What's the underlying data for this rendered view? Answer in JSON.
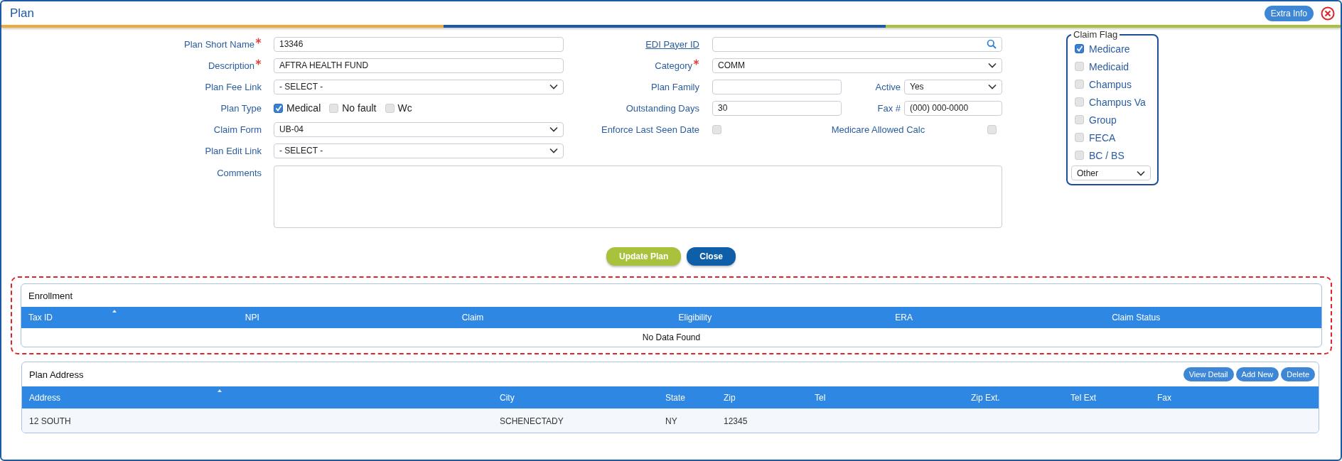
{
  "window": {
    "title": "Plan"
  },
  "extra_info_button": "Extra Info",
  "left_fields": [
    {
      "label": "Plan Short Name",
      "kind": "text",
      "value": "13346",
      "required": true
    },
    {
      "label": "Description",
      "kind": "text",
      "value": "AFTRA HEALTH FUND",
      "required": true
    },
    {
      "label": "Plan Fee Link",
      "kind": "select",
      "value": "- SELECT -",
      "required": false
    },
    {
      "label": "Plan Type",
      "kind": "checks",
      "required": false,
      "options": [
        {
          "label": "Medical",
          "checked": true
        },
        {
          "label": "No fault",
          "checked": false
        },
        {
          "label": "Wc",
          "checked": false
        }
      ]
    },
    {
      "label": "Claim Form",
      "kind": "select",
      "value": "UB-04",
      "required": false
    },
    {
      "label": "Plan Edit Link",
      "kind": "select",
      "value": "- SELECT -",
      "required": false
    },
    {
      "label": "Comments",
      "kind": "textarea",
      "required": false
    }
  ],
  "mid_rows": [
    {
      "fields": [
        {
          "label": "EDI Payer ID",
          "kind": "search",
          "link": true,
          "required": false
        }
      ]
    },
    {
      "fields": [
        {
          "label": "Category",
          "kind": "select",
          "value": "COMM",
          "link": false,
          "required": true
        }
      ]
    },
    {
      "fields": [
        {
          "label": "Plan Family",
          "kind": "text",
          "link": false,
          "required": false
        },
        {
          "label": "Active",
          "kind": "select",
          "value": "Yes",
          "link": false,
          "required": false
        }
      ]
    },
    {
      "fields": [
        {
          "label": "Outstanding Days",
          "kind": "text",
          "value": "30",
          "link": false,
          "required": false
        },
        {
          "label": "Fax #",
          "kind": "text",
          "value": "(000) 000-0000",
          "link": false,
          "required": false
        }
      ]
    },
    {
      "fields": [
        {
          "label": "Enforce Last Seen Date",
          "kind": "checkbox",
          "checked": false,
          "link": false,
          "required": false
        },
        {
          "label": "Medicare Allowed Calc",
          "kind": "checkbox",
          "checked": false,
          "link": false,
          "required": false
        }
      ]
    }
  ],
  "claim_flag": {
    "title": "Claim Flag",
    "options": [
      {
        "label": "Medicare",
        "checked": true
      },
      {
        "label": "Medicaid",
        "checked": false
      },
      {
        "label": "Champus",
        "checked": false
      },
      {
        "label": "Champus Va",
        "checked": false
      },
      {
        "label": "Group",
        "checked": false
      },
      {
        "label": "FECA",
        "checked": false
      },
      {
        "label": "BC / BS",
        "checked": false
      }
    ],
    "select": "Other"
  },
  "buttons": [
    {
      "label": "Update Plan",
      "kind": "primary"
    },
    {
      "label": "Close",
      "kind": "secondary"
    }
  ],
  "enrollment": {
    "title": "Enrollment",
    "columns": [
      "Tax ID",
      "NPI",
      "Claim",
      "Eligibility",
      "ERA",
      "Claim Status"
    ],
    "empty_message": "No Data Found"
  },
  "plan_address": {
    "title": "Plan Address",
    "buttons": [
      "View Detail",
      "Add New",
      "Delete"
    ],
    "columns": [
      "Address",
      "City",
      "State",
      "Zip",
      "Tel",
      "Zip Ext.",
      "Tel Ext",
      "Fax"
    ],
    "rows": [
      {
        "cells": [
          "12 SOUTH",
          "SCHENECTADY",
          "NY",
          "12345"
        ]
      }
    ]
  }
}
